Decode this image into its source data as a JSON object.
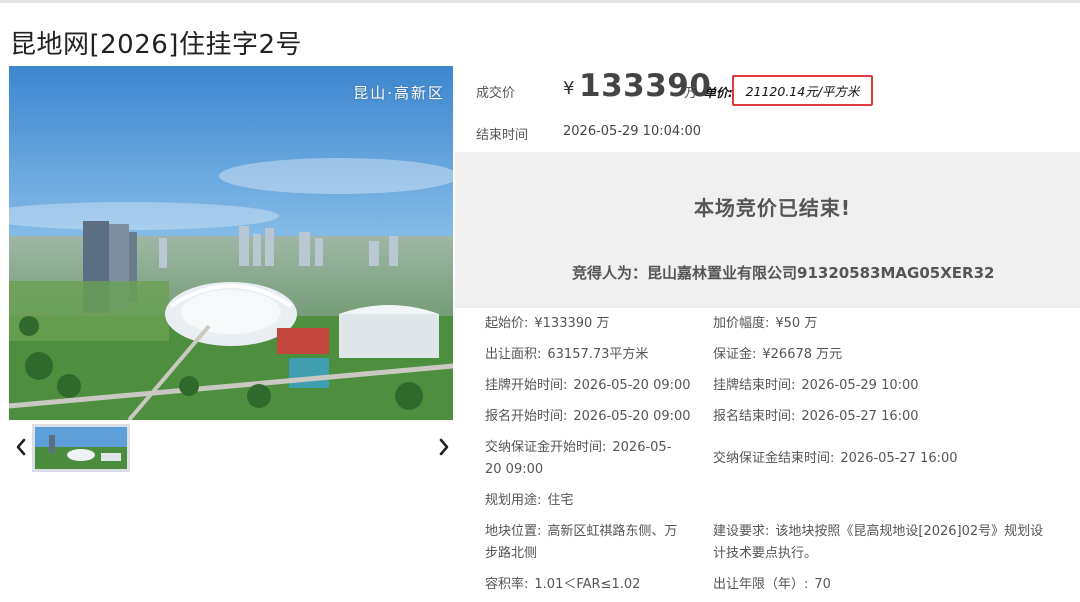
{
  "page": {
    "title": "昆地网[2026]住挂字2号"
  },
  "gallery": {
    "overlay_text": "昆山·高新区",
    "prev_icon": "chevron-left-icon",
    "next_icon": "chevron-right-icon"
  },
  "price": {
    "deal_label": "成交价",
    "currency": "¥",
    "amount": "133390",
    "amount_unit": "万",
    "unit_label": "单价:",
    "unit_price": "21120.14元/平方米",
    "end_label": "结束时间",
    "end_value": "2026-05-29 10:04:00"
  },
  "result": {
    "title": "本场竞价已结束!",
    "winner": "竞得人为：昆山嘉林置业有限公司91320583MAG05XER32"
  },
  "details": {
    "start_price_label": "起始价:",
    "start_price_value": "¥133390 万",
    "increment_label": "加价幅度:",
    "increment_value": "¥50 万",
    "area_label": "出让面积:",
    "area_value": "63157.73平方米",
    "deposit_label": "保证金:",
    "deposit_value": "¥26678 万元",
    "listing_start_label": "挂牌开始时间:",
    "listing_start_value": "2026-05-20 09:00",
    "listing_end_label": "挂牌结束时间:",
    "listing_end_value": "2026-05-29 10:00",
    "signup_start_label": "报名开始时间:",
    "signup_start_value": "2026-05-20 09:00",
    "signup_end_label": "报名结束时间:",
    "signup_end_value": "2026-05-27 16:00",
    "deposit_start_label": "交纳保证金开始时间:",
    "deposit_start_value_a": "2026-05-",
    "deposit_start_value_b": "20 09:00",
    "deposit_end_label": "交纳保证金结束时间:",
    "deposit_end_value": "2026-05-27 16:00",
    "usage_label": "规划用途:",
    "usage_value": "住宅",
    "location_label": "地块位置:",
    "location_value_a": "高新区虹祺路东侧、万",
    "location_value_b": "步路北侧",
    "requirement_label": "建设要求:",
    "requirement_value_a": "该地块按照《昆高规地设[2026]02号》规划设",
    "requirement_value_b": "计技术要点执行。",
    "far_label": "容积率:",
    "far_value": "1.01＜FAR≤1.02",
    "term_label": "出让年限（年）:",
    "term_value": "70"
  }
}
